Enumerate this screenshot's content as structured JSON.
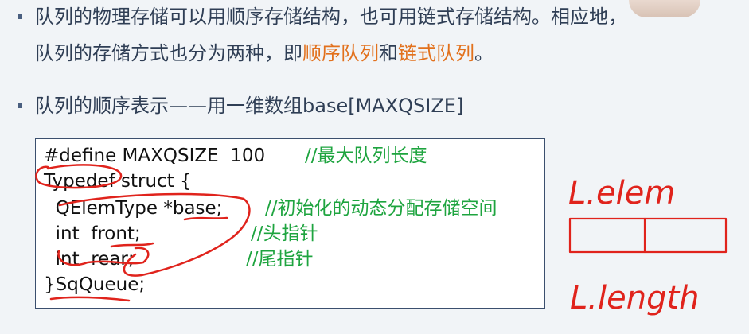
{
  "bullets": {
    "b1_line1": "队列的物理存储可以用顺序存储结构，也可用链式存储结构。相应地，",
    "b1_line2_pre": "队列的存储方式也分为两种，即",
    "b1_hl1": "顺序队列",
    "b1_mid": "和",
    "b1_hl2": "链式队列",
    "b1_end": "。",
    "b2_text": "队列的顺序表示——用一维数组base[MAXQSIZE]"
  },
  "code": {
    "l1": "#define MAXQSIZE  100",
    "c1": "//最大队列长度",
    "l2": "Typedef struct {",
    "l3": "  QElemType *base;",
    "c3": "//初始化的动态分配存储空间",
    "l4": "  int  front;",
    "c4": "//头指针",
    "l5": "  int  rear;",
    "c5": "//尾指针",
    "l6": "}SqQueue;"
  },
  "handwriting": {
    "top": "L.elem",
    "bottom": "L.length"
  },
  "colors": {
    "highlight": "#e2711d",
    "comment": "#1ea43f",
    "ink": "#e0231c"
  }
}
